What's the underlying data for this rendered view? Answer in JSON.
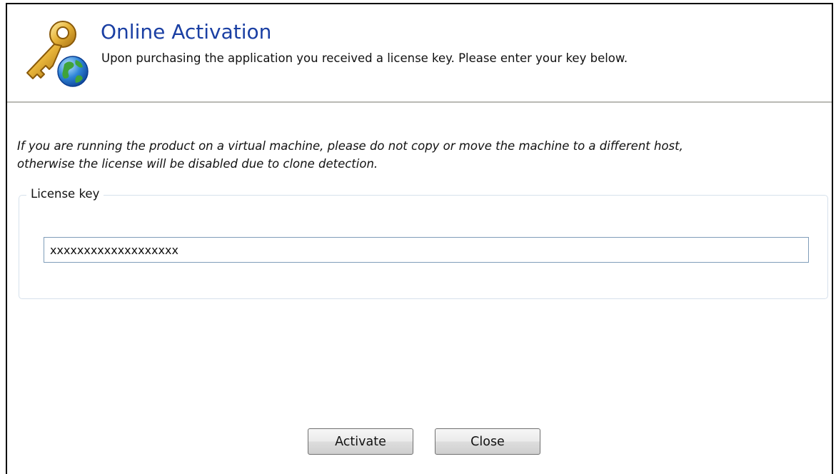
{
  "header": {
    "title": "Online Activation",
    "subtitle": "Upon purchasing the application you received a license key. Please enter your key below.",
    "icon": "key-globe-icon"
  },
  "notice": {
    "line1": "If you are running the product on a virtual machine, please do not copy or move the machine to a different host,",
    "line2": "otherwise the license will be disabled due to clone detection."
  },
  "license": {
    "legend": "License key",
    "value": "xxxxxxxxxxxxxxxxxxx"
  },
  "buttons": {
    "activate": "Activate",
    "close": "Close"
  },
  "colors": {
    "title": "#1a3fa3",
    "divider": "#b9b9b4",
    "group_border": "#d6e1ec",
    "input_border": "#7f9db9"
  }
}
